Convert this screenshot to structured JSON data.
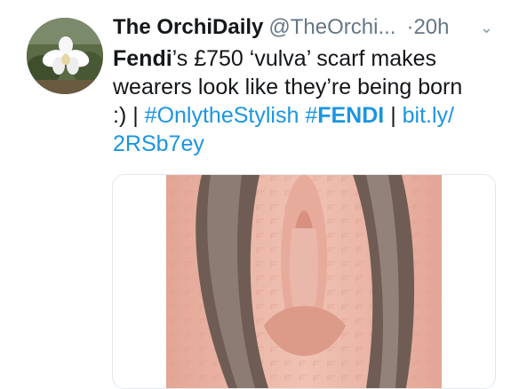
{
  "tweet": {
    "display_name": "The OrchiDaily",
    "handle": "@TheOrchi...",
    "dot": "·",
    "time": "20h",
    "caret": "⌄",
    "text": {
      "brand": "Fendi",
      "line1_rest": "’s £750 ‘vulva’ scarf makes",
      "line2": "wearers look like they’re being born",
      "line3_start": ":) |",
      "hashtag1": "#OnlytheStylish",
      "hashtag2_prefix": "#",
      "hashtag2_bold": "FENDI",
      "sep": "|",
      "link_part1": "bit.ly/",
      "link_part2": "2RSb7ey"
    }
  },
  "colors": {
    "link": "#1b95e0",
    "text": "#14171a",
    "meta": "#657786",
    "scarf_pink": "#e9b2a3",
    "fur": "#6b5a52"
  },
  "icons": {
    "caret": "chevron-down-icon",
    "avatar": "orchid-avatar"
  }
}
